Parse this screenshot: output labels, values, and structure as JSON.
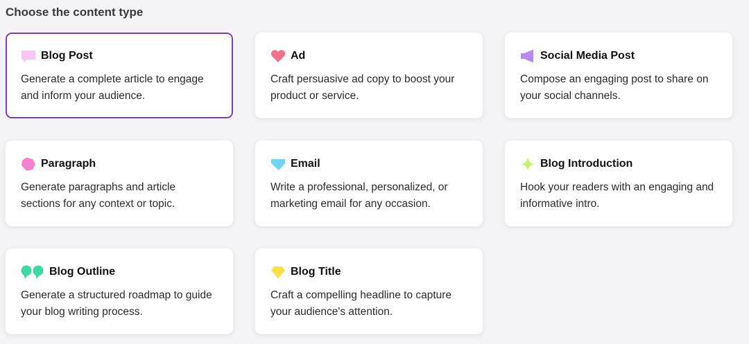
{
  "section": {
    "title": "Choose the content type"
  },
  "colors": {
    "selected_border": "#7a3fbf",
    "card_background": "#ffffff",
    "page_background": "#f4f4f6"
  },
  "cards": [
    {
      "title": "Blog Post",
      "description": "Generate a complete article to engage and inform your audience.",
      "icon": "speech-bubble-icon",
      "icon_color": "#fbc4f7",
      "selected": true
    },
    {
      "title": "Ad",
      "description": "Craft persuasive ad copy to boost your product or service.",
      "icon": "heart-icon",
      "icon_color": "#f2718a",
      "selected": false
    },
    {
      "title": "Social Media Post",
      "description": "Compose an engaging post to share on your social channels.",
      "icon": "megaphone-icon",
      "icon_color": "#b98af0",
      "selected": false
    },
    {
      "title": "Paragraph",
      "description": "Generate paragraphs and article sections for any context or topic.",
      "icon": "pentagon-icon",
      "icon_color": "#f57fd0",
      "selected": false
    },
    {
      "title": "Email",
      "description": "Write a professional, personalized, or marketing email for any occasion.",
      "icon": "envelope-icon",
      "icon_color": "#72d3f5",
      "selected": false
    },
    {
      "title": "Blog Introduction",
      "description": "Hook your readers with an engaging and informative intro.",
      "icon": "sparkle-icon",
      "icon_color": "#c4f26e",
      "selected": false
    },
    {
      "title": "Blog Outline",
      "description": "Generate a structured roadmap to guide your blog writing process.",
      "icon": "quote-icon",
      "icon_color": "#3ed8a0",
      "selected": false
    },
    {
      "title": "Blog Title",
      "description": "Craft a compelling headline to capture your audience's attention.",
      "icon": "diamond-icon",
      "icon_color": "#f9e14a",
      "selected": false
    }
  ]
}
